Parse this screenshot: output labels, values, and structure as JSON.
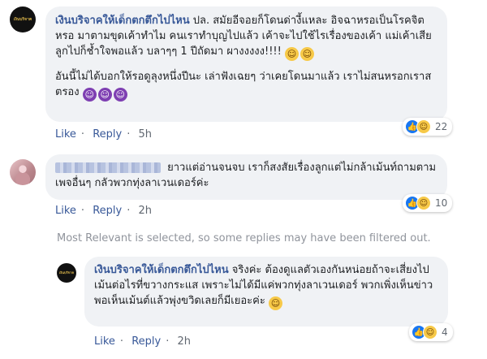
{
  "comments": [
    {
      "author": "เงินบริจาคให้เด็กตกตึกไปไหน",
      "avatar_text": "เงินบริจาค",
      "paragraph1": "ปล. สมัยอีจอยก็โดนด่างี้แหละ อิจฉาหรอเป็นโรคจิตหรอ มาตามขุดเค้าทำไม คนเราทำบุญไปแล้ว เค้าจะไปใช้ไรเรื่องของเค้า แม่เค้าเสียลูกไปก็ช้ำใจพอแล้ว บลาๆๆ 1 ปีถัดมา ผางงงงง!!!!",
      "paragraph2": "อันนี้ไม่ได้บอกให้รอดูลุงหนึ่งปีนะ เล่าฟังเฉยๆ ว่าเคยโดนมาแล้ว เราไม่สนหรอกเราสตรอง",
      "like": "Like",
      "reply": "Reply",
      "time": "5h",
      "reaction_count": "22"
    },
    {
      "author": "",
      "text": "ยาวแต่อ่านจนจบ เราก็สงสัยเรื่องลูกแต่ไม่กล้าเม้นท์ถามตามเพจอื่นๆ กลัวพวกทุ่งลาเวนเดอร์ค่ะ",
      "like": "Like",
      "reply": "Reply",
      "time": "2h",
      "reaction_count": "10"
    },
    {
      "author": "เงินบริจาคให้เด็กตกตึกไปไหน",
      "avatar_text": "เงินบริจาค",
      "text": "จริงค่ะ ต้องดูแลตัวเองกันหน่อยถ้าจะเสี่ยงไปเม้นต่อไรที่ขวางกระแส เพราะไม่ได้มีแค่พวกทุ่งลาเวนเดอร์ พวกเพิ่งเห็นข่าว พอเห็นเม้นต์แล้วพุ่งขวิดเลยก็มีเยอะค่ะ",
      "like": "Like",
      "reply": "Reply",
      "time": "2h",
      "reaction_count": "4"
    }
  ],
  "filtered_notice": "Most Relevant is selected, so some replies may have been filtered out.",
  "icons": {
    "like": "like-reaction-icon",
    "haha": "haha-reaction-icon",
    "laugh_emoji": "tears-of-joy-emoji",
    "devil_emoji": "smiling-devil-emoji"
  },
  "colors": {
    "author": "#385898",
    "bubble": "#f0f2f5",
    "like_blue": "#1877f2"
  }
}
